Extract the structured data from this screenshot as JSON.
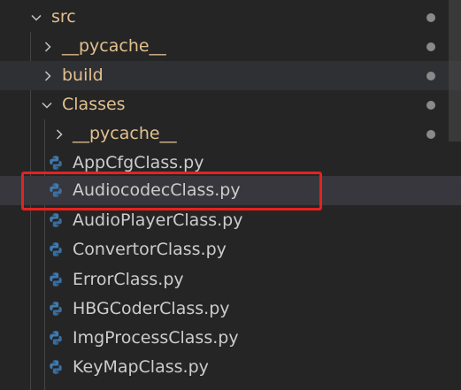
{
  "explorer": {
    "items": [
      {
        "label": "src",
        "type": "folder",
        "expanded": true,
        "depth": 0,
        "modified_dot": true
      },
      {
        "label": "__pycache__",
        "type": "folder",
        "expanded": false,
        "depth": 1,
        "modified_dot": true
      },
      {
        "label": "build",
        "type": "folder",
        "expanded": false,
        "depth": 1,
        "modified_dot": true
      },
      {
        "label": "Classes",
        "type": "folder",
        "expanded": true,
        "depth": 1,
        "modified_dot": true
      },
      {
        "label": "__pycache__",
        "type": "folder",
        "expanded": false,
        "depth": 2,
        "modified_dot": true
      },
      {
        "label": "AppCfgClass.py",
        "type": "python-file",
        "depth": 2
      },
      {
        "label": "AudiocodecClass.py",
        "type": "python-file",
        "depth": 2,
        "selected": true
      },
      {
        "label": "AudioPlayerClass.py",
        "type": "python-file",
        "depth": 2
      },
      {
        "label": "ConvertorClass.py",
        "type": "python-file",
        "depth": 2
      },
      {
        "label": "ErrorClass.py",
        "type": "python-file",
        "depth": 2
      },
      {
        "label": "HBGCoderClass.py",
        "type": "python-file",
        "depth": 2
      },
      {
        "label": "ImgProcessClass.py",
        "type": "python-file",
        "depth": 2
      },
      {
        "label": "KeyMapClass.py",
        "type": "python-file",
        "depth": 2
      }
    ]
  },
  "colors": {
    "background": "#252526",
    "folder_text": "#e2c08d",
    "file_text": "#cccccc",
    "python_blue": "#3d7ab3",
    "python_yellow": "#e8c547",
    "highlight_box": "#e3231f"
  },
  "icons": {
    "expanded": "chevron-down-icon",
    "collapsed": "chevron-right-icon",
    "python": "python-file-icon",
    "modified": "modified-dot-icon"
  }
}
